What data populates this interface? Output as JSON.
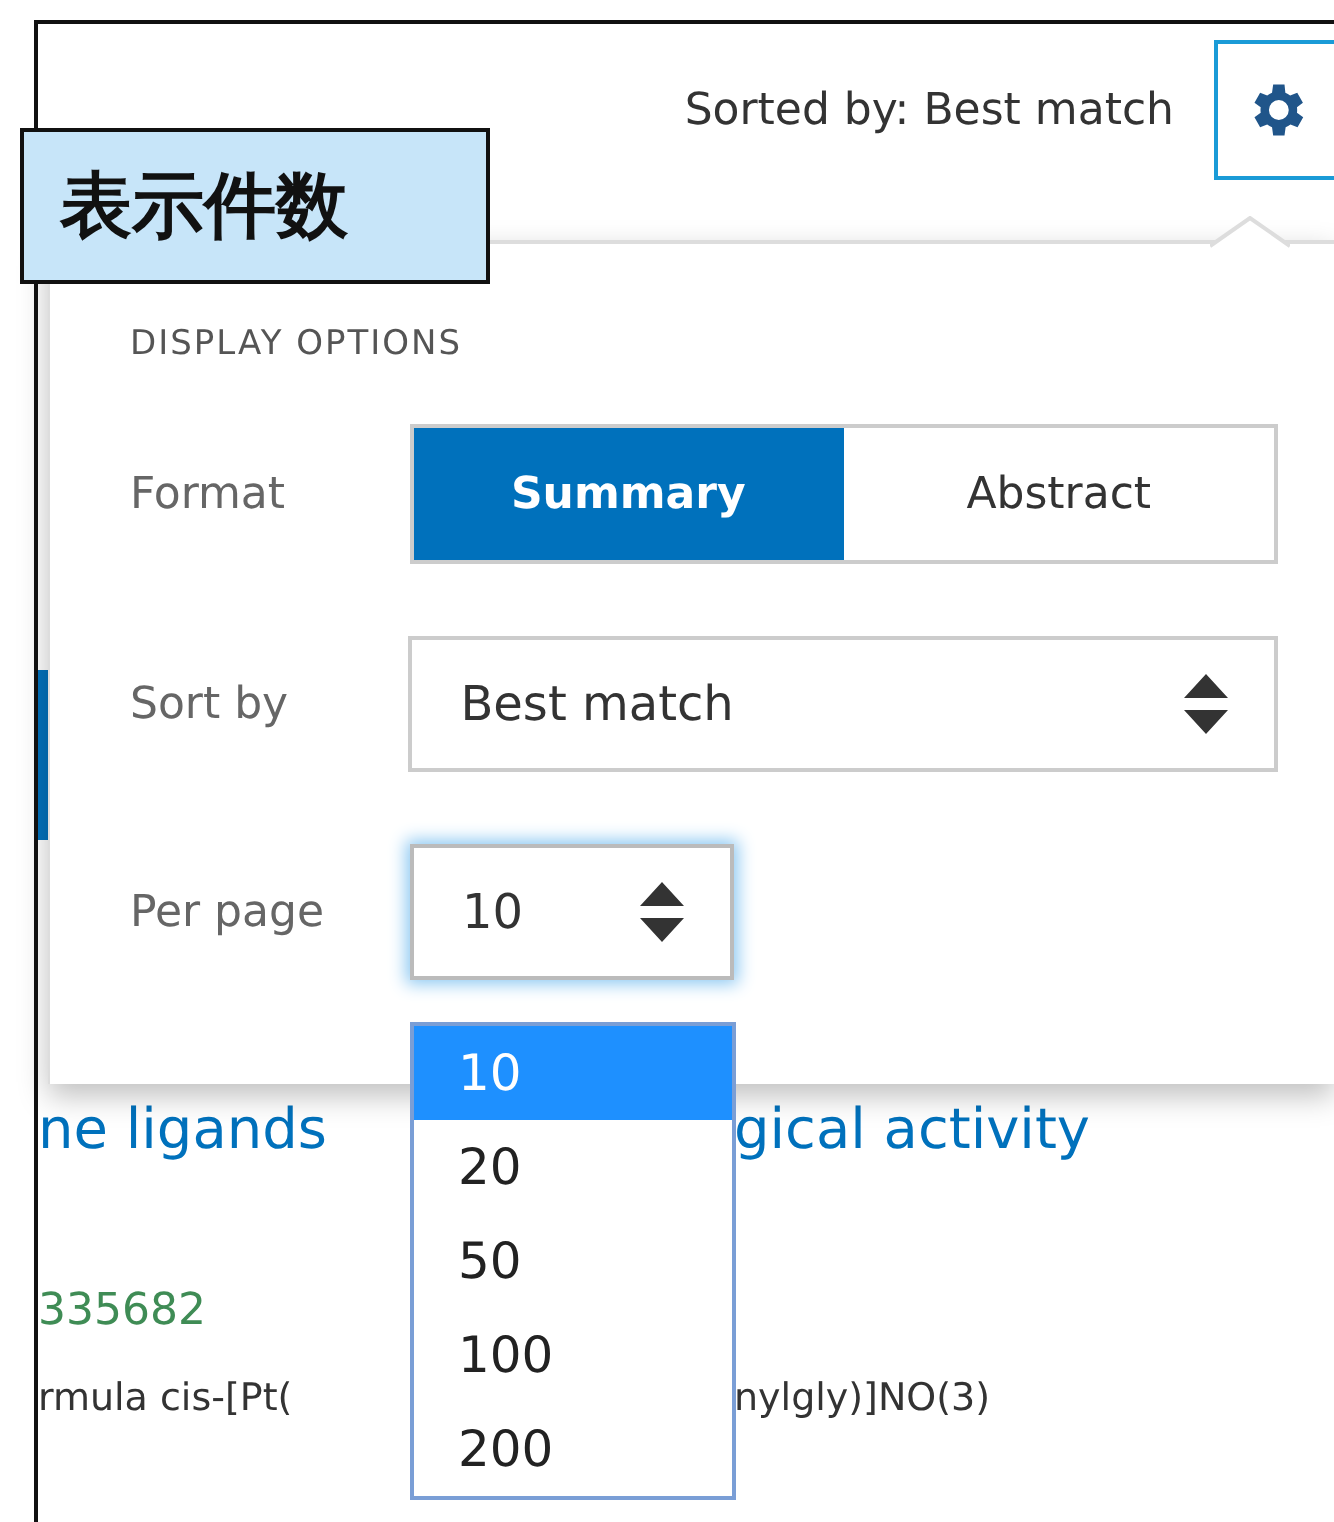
{
  "header": {
    "sort_label": "Sorted by: Best match"
  },
  "annotation_label": "表示件数",
  "display_options": {
    "title": "DISPLAY OPTIONS",
    "format": {
      "label": "Format",
      "options": [
        {
          "label": "Summary",
          "selected": true
        },
        {
          "label": "Abstract",
          "selected": false
        }
      ]
    },
    "sort_by": {
      "label": "Sort by",
      "value": "Best match"
    },
    "per_page": {
      "label": "Per page",
      "value": "10",
      "expanded": true,
      "options": [
        {
          "label": "10",
          "selected": true
        },
        {
          "label": "20",
          "selected": false
        },
        {
          "label": "50",
          "selected": false
        },
        {
          "label": "100",
          "selected": false
        },
        {
          "label": "200",
          "selected": false
        }
      ]
    }
  },
  "results": {
    "title_parts": [
      "ne ligands",
      "gical activity"
    ],
    "pmid": "335682",
    "snippet_parts": [
      "rmula cis-[Pt(",
      "nylgly)]NO(3)"
    ]
  }
}
